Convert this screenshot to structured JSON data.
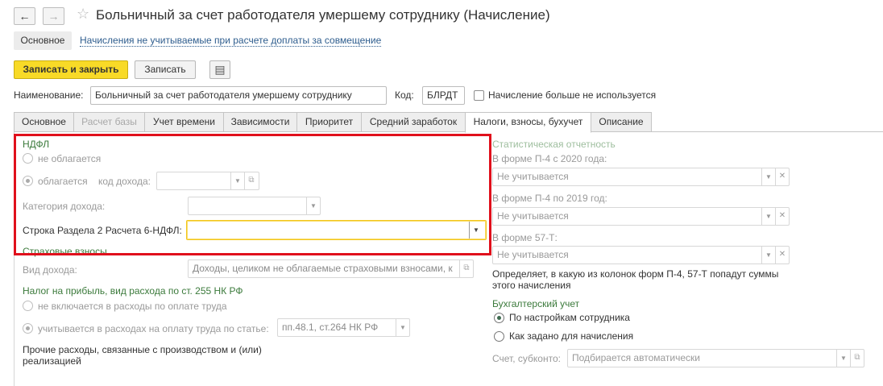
{
  "window": {
    "title": "Больничный за счет работодателя умершему сотруднику (Начисление)",
    "back_label": "←",
    "forward_label": "→",
    "favorite_label": "☆"
  },
  "menu": {
    "main_label": "Основное",
    "link_label": "Начисления не учитываемые при расчете доплаты за совмещение"
  },
  "toolbar": {
    "save_close_label": "Записать и закрыть",
    "save_label": "Записать",
    "doc_icon_label": "▤"
  },
  "header": {
    "name_label": "Наименование:",
    "name_value": "Больничный за счет работодателя умершему сотруднику",
    "code_label": "Код:",
    "code_value": "БЛРДТ",
    "not_used_label": "Начисление больше не используется"
  },
  "tabs": [
    {
      "label": "Основное"
    },
    {
      "label": "Расчет базы"
    },
    {
      "label": "Учет времени"
    },
    {
      "label": "Зависимости"
    },
    {
      "label": "Приоритет"
    },
    {
      "label": "Средний заработок"
    },
    {
      "label": "Налоги, взносы, бухучет"
    },
    {
      "label": "Описание"
    }
  ],
  "ndfl": {
    "section_label": "НДФЛ",
    "not_taxed_label": "не облагается",
    "taxed_label": "облагается",
    "income_code_label": "код дохода:",
    "income_category_label": "Категория дохода:",
    "row6_label": "Строка Раздела 2 Расчета 6-НДФЛ:",
    "row6_value": ""
  },
  "insurance": {
    "section_label": "Страховые взносы",
    "income_type_label": "Вид дохода:",
    "income_type_value": "Доходы, целиком не облагаемые страховыми взносами, к"
  },
  "profit_tax": {
    "section_label": "Налог на прибыль, вид расхода по ст. 255 НК РФ",
    "not_included_label": "не включается в расходы по оплате труда",
    "included_label": "учитывается в расходах на оплату труда по статье:",
    "article_value": "пп.48.1, ст.264 НК РФ",
    "other_expenses_label": "Прочие расходы, связанные с производством и (или) реализацией"
  },
  "stats": {
    "section_label": "Статистическая отчетность",
    "p4_2020_label": "В форме П-4 с 2020 года:",
    "p4_2020_value": "Не учитывается",
    "p4_2019_label": "В форме П-4 по 2019 год:",
    "p4_2019_value": "Не учитывается",
    "f57_label": "В форме 57-Т:",
    "f57_value": "Не учитывается",
    "note": "Определяет, в какую из колонок форм П-4, 57-Т попадут суммы этого начисления"
  },
  "accounting": {
    "section_label": "Бухгалтерский учет",
    "by_employee_label": "По настройкам сотрудника",
    "by_accrual_label": "Как задано для начисления",
    "account_label": "Счет, субконто:",
    "account_value": "Подбирается автоматически"
  },
  "colors": {
    "accent_yellow": "#f8da27",
    "highlight_red": "#e0101c",
    "section_green": "#3b7a3b",
    "link_blue": "#2e5d8e"
  }
}
